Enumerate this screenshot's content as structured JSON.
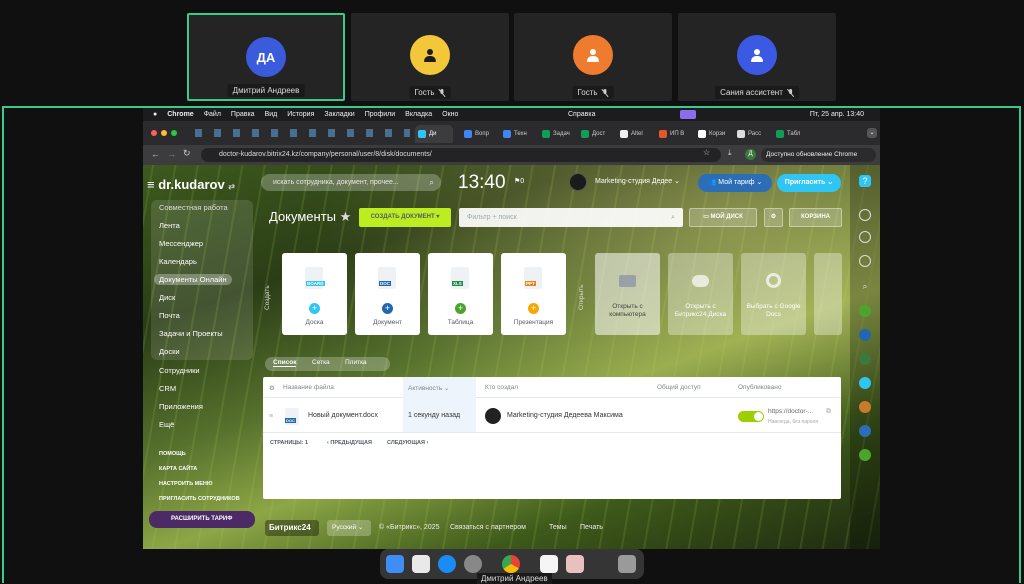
{
  "participants": [
    {
      "name": "Дмитрий Андреев",
      "initials": "ДА",
      "color": "#3a5bdc",
      "muted": false,
      "active": true
    },
    {
      "name": "Гость",
      "initials": "",
      "color": "#f3c73a",
      "muted": true,
      "active": false
    },
    {
      "name": "Гость",
      "initials": "",
      "color": "#ef7b2e",
      "muted": true,
      "active": false
    },
    {
      "name": "Сания ассистент",
      "initials": "",
      "color": "#3c59e3",
      "muted": true,
      "active": false
    }
  ],
  "menubar": {
    "items": [
      "Chrome",
      "Файл",
      "Правка",
      "Вид",
      "История",
      "Закладки",
      "Профили",
      "Вкладка",
      "Окно"
    ],
    "center": "Справка",
    "datetime": "Пт, 25 апр.  13:40"
  },
  "browser": {
    "tabs": [
      "Ди",
      "Вопр",
      "Техн",
      "Задач",
      "Дост",
      "Altel",
      "ИП В",
      "Корзи",
      "Расс",
      "Табл"
    ],
    "url": "doctor-kudarov.bitrix24.kz/company/personal/user/8/disk/documents/",
    "update_label": "Доступно обновление Chrome"
  },
  "bitrix": {
    "logo": "dr.kudarov",
    "menu": [
      "Совместная работа",
      "Лента",
      "Мессенджер",
      "Календарь",
      "Документы Онлайн",
      "Диск",
      "Почта",
      "Задачи и Проекты",
      "Доски",
      "Сотрудники",
      "CRM",
      "Приложения",
      "Ещё"
    ],
    "active_menu": "Документы Онлайн",
    "small_links": [
      "Помощь",
      "Карта сайта",
      "Настроить меню",
      "Пригласить сотрудников"
    ],
    "expand_label": "Расширить тариф",
    "search_placeholder": "искать сотрудника, документ, прочее...",
    "time": "13:40",
    "company": "Marketing-студия Дедее",
    "tariff_label": "Мой тариф",
    "invite_label": "Пригласить",
    "page_title": "Документы",
    "create_label": "Создать документ",
    "filter_placeholder": "Фильтр + поиск",
    "my_disk_label": "Мой диск",
    "trash_label": "Корзина",
    "create_side_label": "Создать",
    "open_side_label": "Открыть",
    "create_cards": [
      {
        "label": "Доска",
        "badge": "BOARD",
        "badge_color": "#2fc6f6",
        "plus_color": "#2fc6f6"
      },
      {
        "label": "Документ",
        "badge": "DOC",
        "badge_color": "#2067b0",
        "plus_color": "#2067b0"
      },
      {
        "label": "Таблица",
        "badge": "XLS",
        "badge_color": "#1f8c43",
        "plus_color": "#4ca52b"
      },
      {
        "label": "Презентация",
        "badge": "PPT",
        "badge_color": "#e8861b",
        "plus_color": "#f7a700"
      }
    ],
    "open_cards": [
      "Открыть с компьютера",
      "Открыть с Битрикс24.Диска",
      "Выбрать с Google Docs"
    ],
    "view_tabs": [
      "Список",
      "Сетка",
      "Плитка"
    ],
    "table": {
      "headers": [
        "Название файла",
        "Активность",
        "Кто создал",
        "Общий доступ",
        "Опубликовано"
      ],
      "row": {
        "name": "Новый документ.docx",
        "activity": "1 секунду назад",
        "creator": "Marketing-студия Дедеева Максима",
        "link": "https://doctor-...",
        "link_note": "Навсегда, без пароля"
      },
      "pages_label": "СТРАНИЦЫ:",
      "page": "1",
      "prev_label": "ПРЕДЫДУЩАЯ",
      "next_label": "СЛЕДУЮЩАЯ"
    },
    "footer": {
      "brand": "Битрикс24",
      "lang": "Русский",
      "copyright": "© «Битрикс», 2025",
      "partner": "Связаться с партнером",
      "themes": "Темы",
      "print": "Печать"
    }
  },
  "dock_caption": "Дмитрий Андреев"
}
